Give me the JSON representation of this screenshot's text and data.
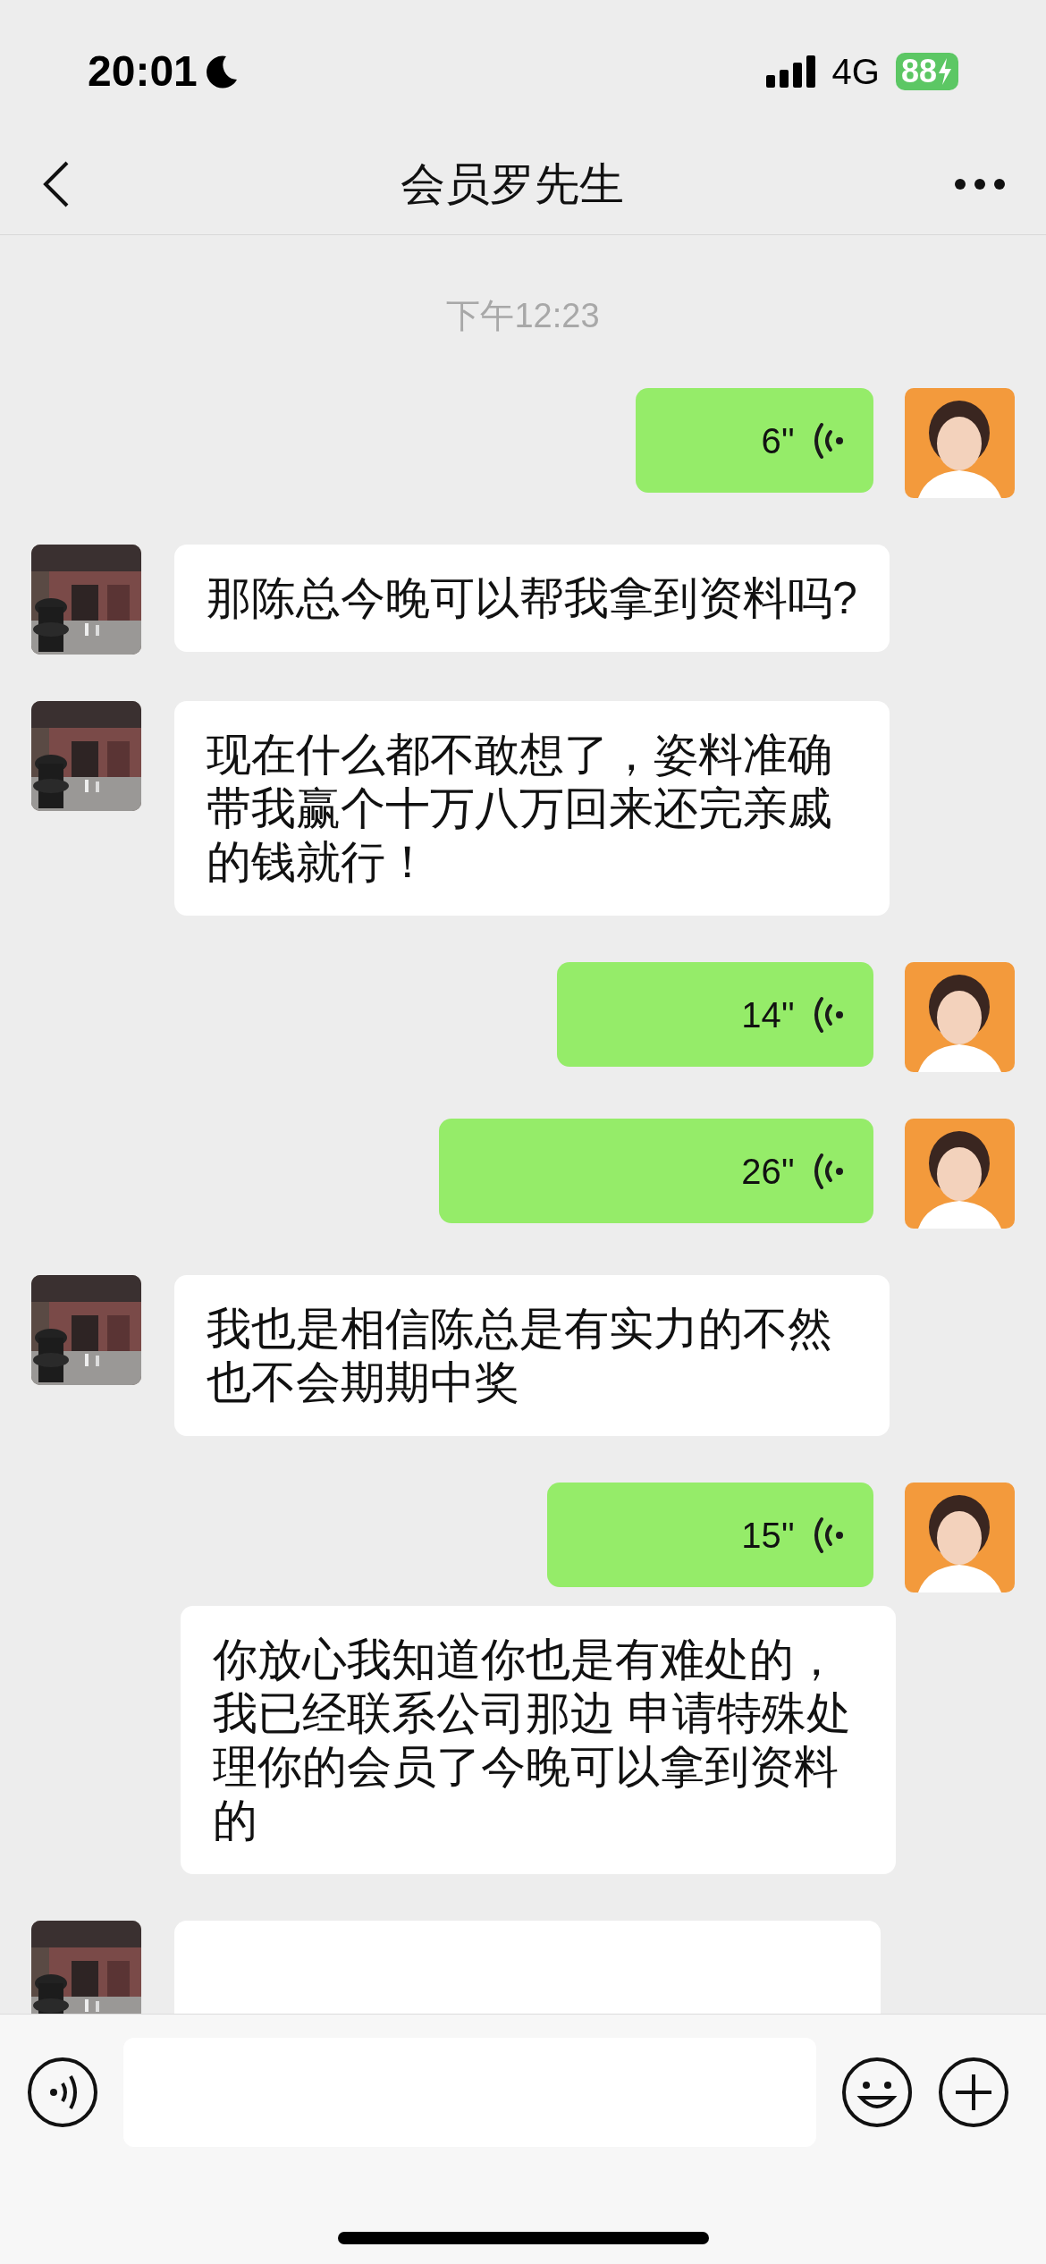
{
  "status_bar": {
    "time": "20:01",
    "network": "4G",
    "battery": "88",
    "charging": true
  },
  "header": {
    "title": "会员罗先生"
  },
  "timestamp": "下午12:23",
  "messages": [
    {
      "kind": "voice_out",
      "duration": "6''"
    },
    {
      "kind": "text_in",
      "avatar": true,
      "text": "那陈总今晚可以帮我拿到资料吗?"
    },
    {
      "kind": "text_in",
      "avatar": true,
      "text": "现在什么都不敢想了，姿料准确带我赢个十万八万回来还完亲戚的钱就行！"
    },
    {
      "kind": "voice_out",
      "duration": "14''"
    },
    {
      "kind": "voice_out",
      "duration": "26''"
    },
    {
      "kind": "text_in",
      "avatar": true,
      "text": "我也是相信陈总是有实力的不然也不会期期中奖"
    },
    {
      "kind": "voice_out",
      "duration": "15''"
    },
    {
      "kind": "text_in",
      "avatar": false,
      "text": "你放心我知道你也是有难处的，我已经联系公司那边 申请特殊处理你的会员了今晚可以拿到资料的"
    },
    {
      "kind": "cut_in",
      "avatar": true
    }
  ]
}
